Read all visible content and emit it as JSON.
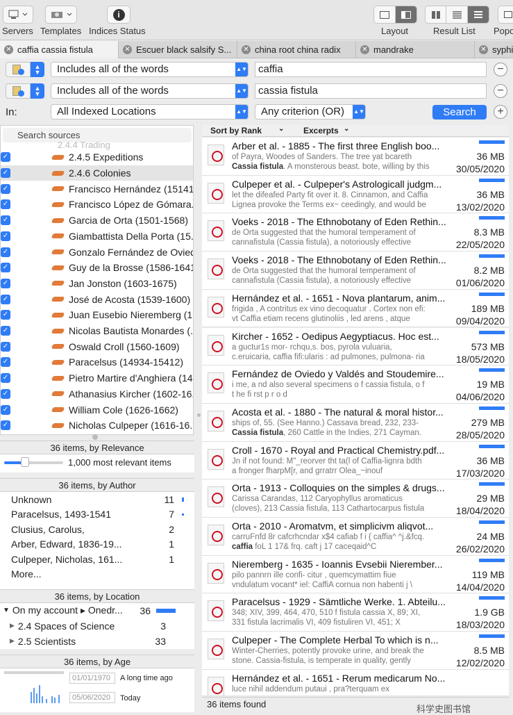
{
  "toolbar": {
    "servers": "Servers",
    "templates": "Templates",
    "indices_status": "Indices Status",
    "layout": "Layout",
    "result_list": "Result List",
    "popover": "Popo"
  },
  "tabs": [
    {
      "label": "caffia cassia fistula"
    },
    {
      "label": "Escuer black salsify S..."
    },
    {
      "label": "china root china radix"
    },
    {
      "label": "mandrake"
    },
    {
      "label": "syphi"
    }
  ],
  "search": {
    "rows": [
      {
        "operator": "Includes all of the words",
        "value": "caffia"
      },
      {
        "operator": "Includes all of the words",
        "value": "cassia fistula"
      }
    ],
    "in_label": "In:",
    "location": "All Indexed Locations",
    "criterion": "Any criterion (OR)",
    "search_button": "Search",
    "sources_placeholder": "Search sources",
    "sources_partial": "2.4.4 Trading"
  },
  "sources": [
    {
      "label": "2.4.5 Expeditions",
      "selected": false
    },
    {
      "label": "2.4.6 Colonies",
      "selected": true
    },
    {
      "label": "Francisco Hernández (15141..."
    },
    {
      "label": "Francisco López de Gómara..."
    },
    {
      "label": "Garcia de Orta (1501-1568)"
    },
    {
      "label": "Giambattista Della Porta (15..."
    },
    {
      "label": "Gonzalo Fernández de Ovied..."
    },
    {
      "label": "Guy de la Brosse (1586-1641)"
    },
    {
      "label": "Jan Jonston (1603-1675)"
    },
    {
      "label": "José de Acosta (1539-1600)"
    },
    {
      "label": "Juan Eusebio Nieremberg (1..."
    },
    {
      "label": "Nicolas Bautista Monardes (..."
    },
    {
      "label": "Oswald Croll (1560-1609)"
    },
    {
      "label": "Paracelsus (14934-15412)"
    },
    {
      "label": "Pietro Martire d'Anghiera (14..."
    },
    {
      "label": "Athanasius Kircher (1602-16..."
    },
    {
      "label": "William Cole (1626-1662)"
    },
    {
      "label": "Nicholas Culpeper (1616-16..."
    }
  ],
  "relevance": {
    "header": "36 items, by Relevance",
    "label": "1,000 most relevant items",
    "level": 0.35
  },
  "author": {
    "header": "36 items, by Author",
    "items": [
      {
        "name": "Unknown",
        "count": "11"
      },
      {
        "name": "Paracelsus, 1493-1541",
        "count": "7"
      },
      {
        "name": "Clusius, Carolus,",
        "count": "2"
      },
      {
        "name": "Arber, Edward, 1836-19...",
        "count": "1"
      },
      {
        "name": "Culpeper, Nicholas, 161...",
        "count": "1"
      }
    ],
    "more": "More..."
  },
  "location": {
    "header": "36 items, by Location",
    "items": [
      {
        "name": "On my account ▸ Onedr...",
        "count": "36"
      },
      {
        "name": "2.4 Spaces of Science",
        "count": "3"
      },
      {
        "name": "2.5 Scientists",
        "count": "33"
      }
    ]
  },
  "age": {
    "header": "36 items, by Age",
    "from_date": "01/01/1970",
    "from_label": "A long time ago",
    "to_date": "05/06/2020",
    "to_label": "Today"
  },
  "results_header": {
    "sort": "Sort by Rank",
    "excerpts": "Excerpts"
  },
  "results": [
    {
      "title": "Arber et al. - 1885 - The first three English boo...",
      "l1": "of Payra, Woodes of Sanders. The tree yat bcareth",
      "l2a": "Cassia fistula",
      "l2b": ". A monsterous beast. bote, willing by this",
      "size": "36 MB",
      "date": "30/05/2020"
    },
    {
      "title": "Culpeper et al. - Culpeper's Astrologicall judgm...",
      "l1": "let the difeafed Party fit over it. 8. Cinnamon, and Caffia",
      "l2a": "",
      "l2b": "Lignea provoke the Terms ex~ ceedingly, and would be",
      "size": "36 MB",
      "date": "13/02/2020"
    },
    {
      "title": "Voeks - 2018 - The Ethnobotany of Eden Rethin...",
      "l1": "de Orta suggested that the humoral temperament of",
      "l2a": "",
      "l2b": "cannafistula (Cassia fistula), a notoriously effective",
      "size": "8.3 MB",
      "date": "22/05/2020"
    },
    {
      "title": "Voeks - 2018 - The Ethnobotany of Eden Rethin...",
      "l1": "de Orta suggested that the humoral temperament of",
      "l2a": "",
      "l2b": "cannafistula (Cassia fistula), a notoriously effective",
      "size": "8.2 MB",
      "date": "01/06/2020"
    },
    {
      "title": "Hernández et al. - 1651 - Nova plantarum, anim...",
      "l1": "frigida , A contritus ex vino decoquatur . Cortex non efi:",
      "l2a": "",
      "l2b": "vt Caffia etiam recens glutinoliis , led arens , atque",
      "size": "189 MB",
      "date": "09/04/2020"
    },
    {
      "title": "Kircher - 1652 - Oedipus Aegyptiacus. Hoc est...",
      "l1": "a guctur1s mor- rchqu,s. bos, pyrola vuluaria,",
      "l2a": "",
      "l2b": "c.eruicaria, caffia fifi:ularis : ad pulmones, pulmona- ria",
      "size": "573 MB",
      "date": "18/05/2020"
    },
    {
      "title": "Fernández de Oviedo y Valdés and Stoudemire...",
      "l1": "i me, a nd also several specimens o f cassia fistula, o f",
      "l2a": "",
      "l2b": "t he fi rst p r o d",
      "size": "19 MB",
      "date": "04/06/2020"
    },
    {
      "title": "Acosta et al. - 1880 - The natural & moral histor...",
      "l1": "ships of, 55. (See Hanno.) Cassava bread, 232, 233-",
      "l2a": "Cassia fistula",
      "l2b": ", 260 Cattle in the Indies, 271 Cayman.",
      "size": "279 MB",
      "date": "28/05/2020"
    },
    {
      "title": "Croll - 1670 - Royal and Practical Chemistry.pdf...",
      "l1": "Jn if not found: M\"_reorver tht ta(l of Caffia-lignra bdth",
      "l2a": "",
      "l2b": "a fronger fharpM[r, and grratrr Olea_~inouf",
      "size": "36 MB",
      "date": "17/03/2020"
    },
    {
      "title": "Orta - 1913 - Colloquies on the simples & drugs...",
      "l1": "Carissa Carandas, 112 Caryophyllus aromaticus",
      "l2a": "",
      "l2b": "(cloves), 213 Cassia fistula, 113 Cathartocarpus fistula",
      "size": "29 MB",
      "date": "18/04/2020"
    },
    {
      "title": "Orta - 2010 - Aromatvm, et simplicivm aliqvot...",
      "l1": "carruFnfd 8r cafcrhcndar x$4 cafiab f i { caffia^ ^j.&fcq.",
      "l2a": "caffia",
      "l2b": " foL 1 17& frq. caft j 17 caceqaid^C",
      "size": "24 MB",
      "date": "26/02/2020"
    },
    {
      "title": "Nieremberg - 1635 - Ioannis Evsebii Nierember...",
      "l1": "pilo pannrn ille confi- citur , quemcymattim fiue",
      "l2a": "",
      "l2b": "vndulatum vocant* iel: CaffiA cornua non habenti j \\",
      "size": "119 MB",
      "date": "14/04/2020"
    },
    {
      "title": "Paracelsus - 1929 - Sämtliche Werke. 1. Abteilu...",
      "l1": "348; XIV, 399, 464, 470, 510 f fistula cassia X, 89; XI,",
      "l2a": "",
      "l2b": "331 fistula lacrimalis VI, 409 fistuliren VI, 451; X",
      "size": "1.9 GB",
      "date": "18/03/2020"
    },
    {
      "title": "Culpeper - The Complete Herbal  To which is n...",
      "l1": "Winter-Cherries, potently provoke urine, and break the",
      "l2a": "",
      "l2b": "stone. Cassia-fistula, is temperate in quality, gently",
      "size": "8.5 MB",
      "date": "12/02/2020"
    },
    {
      "title": "Hernández et al. - 1651 - Rerum medicarum No...",
      "l1": "luce nihil addendum putaui , pra?terquam ex",
      "l2a": "",
      "l2b": "",
      "size": "",
      "date": ""
    }
  ],
  "status": "36 items found",
  "watermark": "科学史图书馆",
  "colors": {
    "accent": "#2f7cf6",
    "folder": "#e07b39",
    "pdf": "#c12"
  }
}
